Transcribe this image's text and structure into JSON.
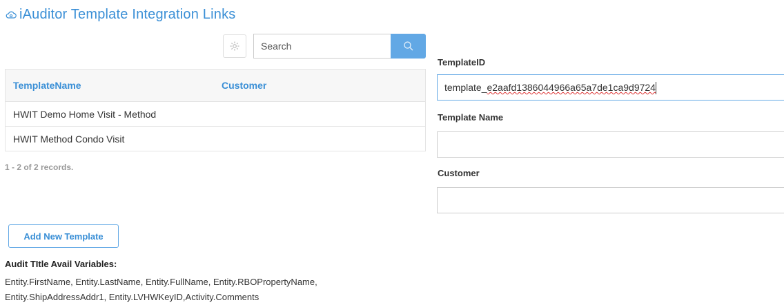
{
  "header": {
    "title": "iAuditor Template Integration Links",
    "logo_icon": "cloud-cog-icon"
  },
  "toolbar": {
    "gear_icon": "gear-icon",
    "search_placeholder": "Search",
    "search_icon": "search-icon"
  },
  "table": {
    "columns": [
      "TemplateName",
      "Customer"
    ],
    "rows": [
      {
        "name": "HWIT Demo Home Visit - Method",
        "customer": ""
      },
      {
        "name": "HWIT Method Condo Visit",
        "customer": ""
      }
    ],
    "record_count": "1 - 2 of 2 records."
  },
  "actions": {
    "add_label": "Add New Template"
  },
  "variables": {
    "title": "Audit TItle Avail Variables:",
    "line1": "Entity.FirstName, Entity.LastName, Entity.FullName, Entity.RBOPropertyName,",
    "line2": "Entity.ShipAddressAddr1, Entity.LVHWKeyID,Activity.Comments"
  },
  "form": {
    "template_id_label": "TemplateID",
    "template_id_prefix": "template_",
    "template_id_rest": "e2aafd1386044966a65a7de1ca9d9724",
    "template_name_label": "Template Name",
    "template_name_value": "",
    "customer_label": "Customer",
    "customer_value": ""
  },
  "colors": {
    "accent": "#3a8fd6",
    "search_button": "#62a8e5"
  }
}
